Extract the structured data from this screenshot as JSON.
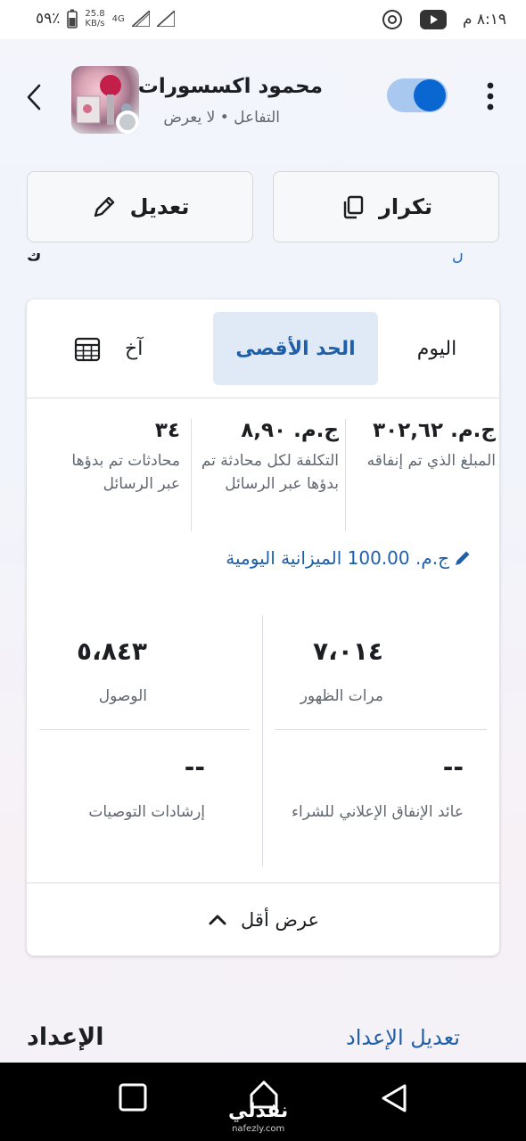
{
  "status_bar": {
    "battery": "٥٩٪",
    "net_speed_value": "25.8",
    "net_speed_unit": "KB/s",
    "network": "4G",
    "time": "٨:١٩ م"
  },
  "header": {
    "campaign_name": "محمود اكسسورات",
    "status_text": "التفاعل • لا يعرض",
    "toggle_on": true
  },
  "actions": {
    "edit_label": "تعديل",
    "duplicate_label": "تكرار"
  },
  "clipped_row": {
    "left_text": "ك",
    "right_text": "ل"
  },
  "tabs": {
    "today": "اليوم",
    "max": "الحد الأقصى",
    "other": "آخ"
  },
  "stats": [
    {
      "value": "ج.م. ٣٠٢,٦٢",
      "label": "المبلغ الذي تم إنفاقه"
    },
    {
      "value": "ج.م. ٨,٩٠",
      "label": "التكلفة لكل محادثة تم بدؤها عبر الرسائل"
    },
    {
      "value": "٣٤",
      "label": "محادثات تم بدؤها عبر الرسائل"
    }
  ],
  "budget_text": "ج.م. 100.00 الميزانية اليومية",
  "metrics": [
    {
      "value": "٧،٠١٤",
      "label": "مرات الظهور"
    },
    {
      "value": "٥،٨٤٣",
      "label": "الوصول"
    },
    {
      "value": "--",
      "label": "عائد الإنفاق الإعلاني للشراء"
    },
    {
      "value": "--",
      "label": "إرشادات التوصيات"
    }
  ],
  "show_less": "عرض أقل",
  "setup": {
    "title": "الإعداد",
    "edit": "تعديل الإعداد"
  },
  "watermark": {
    "main": "نفذلي",
    "url": "nafezly.com"
  },
  "colors": {
    "accent": "#1f5fa8",
    "toggle_track": "#a8c8ef",
    "toggle_knob": "#0a66d1",
    "selected_tab_bg": "#dfeaf6"
  }
}
